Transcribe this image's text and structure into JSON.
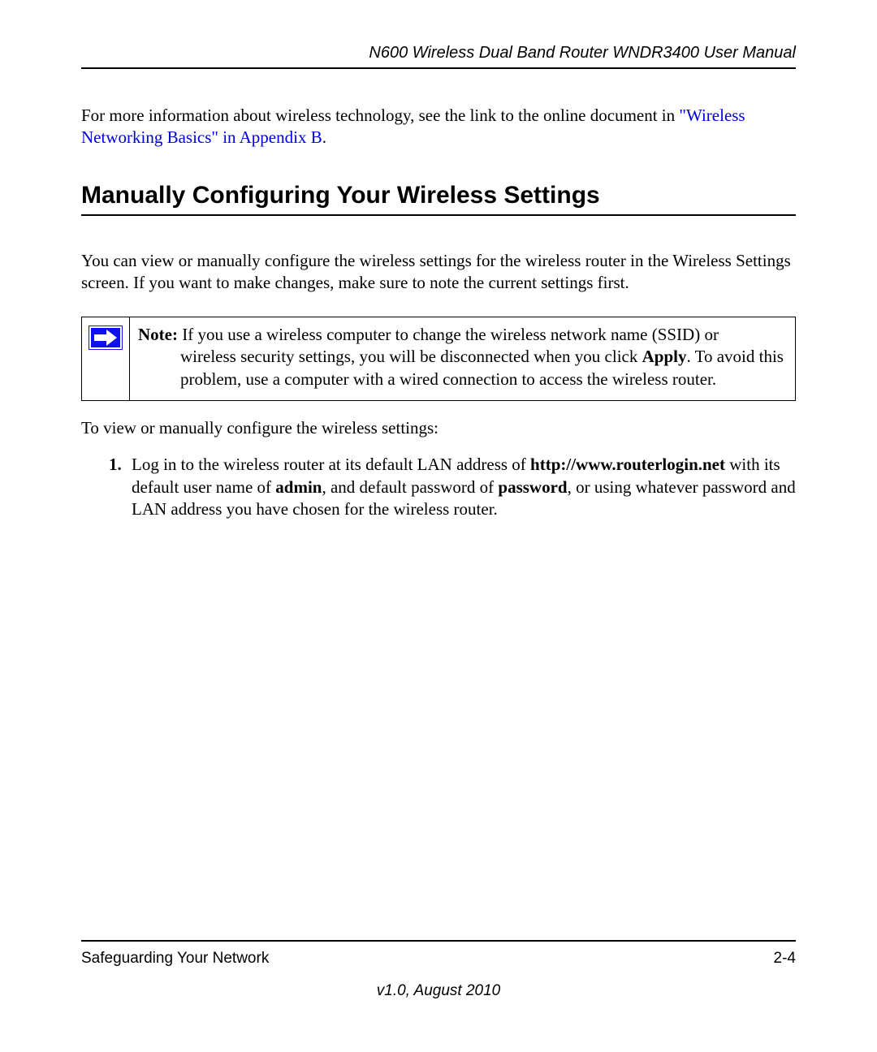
{
  "header": {
    "title": "N600 Wireless Dual Band Router WNDR3400 User Manual"
  },
  "intro": {
    "prefix": "For more information about wireless technology, see the link to the online document in ",
    "link": "\"Wireless Networking Basics\" in Appendix B",
    "suffix": "."
  },
  "section_heading": "Manually Configuring Your Wireless Settings",
  "body_para": "You can view or manually configure the wireless settings for the wireless router in the Wireless Settings screen. If you want to make changes, make sure to note the current settings first.",
  "note": {
    "label": "Note:",
    "line1_after_label": " If you use a wireless computer to change the wireless network name (SSID) or ",
    "rest_before_apply": "wireless security settings, you will be disconnected when you click ",
    "apply": "Apply",
    "rest_after_apply": ". To avoid this problem, use a computer with a wired connection to access the wireless router."
  },
  "post_note": "To view or manually configure the wireless settings:",
  "step1": {
    "number": "1.",
    "t1": "Log in to the wireless router at its default LAN address of ",
    "url": "http://www.routerlogin.net",
    "t2": " with its default user name of ",
    "admin": "admin",
    "t3": ", and default password of ",
    "password": "password",
    "t4": ", or using whatever password and LAN address you have chosen for the wireless router."
  },
  "footer": {
    "left": "Safeguarding Your Network",
    "right": "2-4",
    "version": "v1.0, August 2010"
  }
}
